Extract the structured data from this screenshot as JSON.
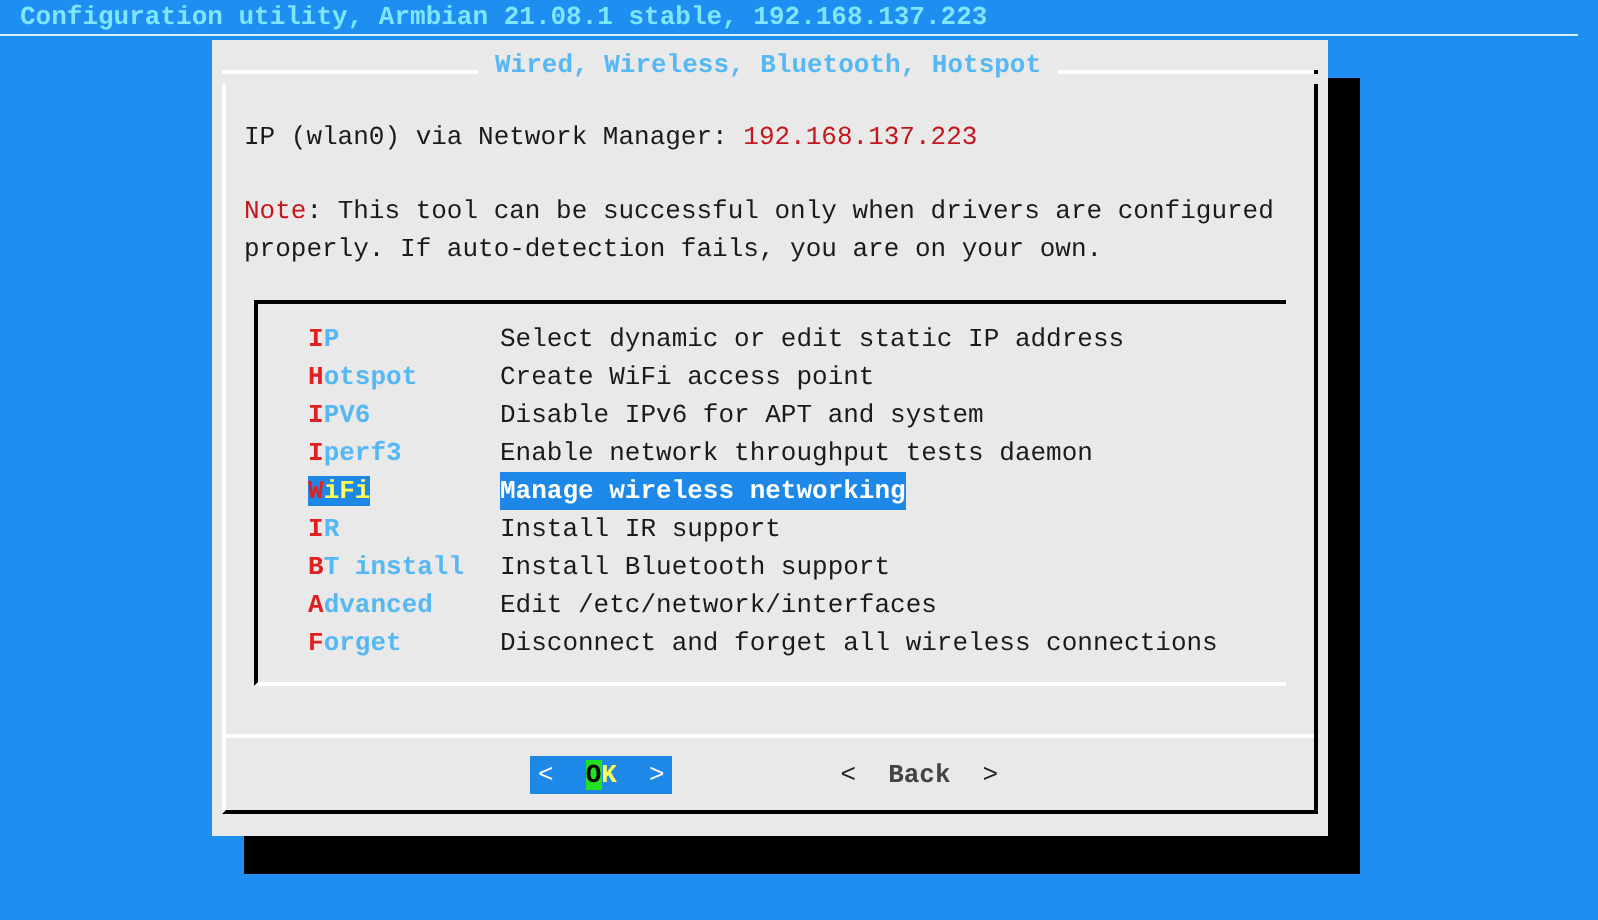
{
  "window": {
    "title": "Configuration utility, Armbian 21.08.1 stable, 192.168.137.223"
  },
  "dialog": {
    "title": "Wired, Wireless, Bluetooth, Hotspot",
    "ip_label": "IP (wlan0) via Network Manager:",
    "ip_value": "192.168.137.223",
    "note_label": "Note",
    "note_text": ": This tool can be successful only when drivers are configured properly. If auto-detection fails, you are on your own.",
    "menu": [
      {
        "tag": "IP",
        "description": "Select dynamic or edit static IP address",
        "selected": false
      },
      {
        "tag": "Hotspot",
        "description": "Create WiFi access point",
        "selected": false
      },
      {
        "tag": "IPV6",
        "description": "Disable IPv6 for APT and system",
        "selected": false
      },
      {
        "tag": "Iperf3",
        "description": "Enable network throughput tests daemon",
        "selected": false
      },
      {
        "tag": "WiFi",
        "description": "Manage wireless networking",
        "selected": true
      },
      {
        "tag": "IR",
        "description": "Install IR support",
        "selected": false
      },
      {
        "tag": "BT install",
        "description": "Install Bluetooth support",
        "selected": false
      },
      {
        "tag": "Advanced",
        "description": "Edit /etc/network/interfaces",
        "selected": false
      },
      {
        "tag": "Forget",
        "description": "Disconnect and forget all wireless connections",
        "selected": false
      }
    ],
    "buttons": [
      {
        "open": "<",
        "label": "OK",
        "close": ">",
        "selected": true
      },
      {
        "open": "<",
        "label": "Back",
        "close": ">",
        "selected": false
      }
    ]
  }
}
